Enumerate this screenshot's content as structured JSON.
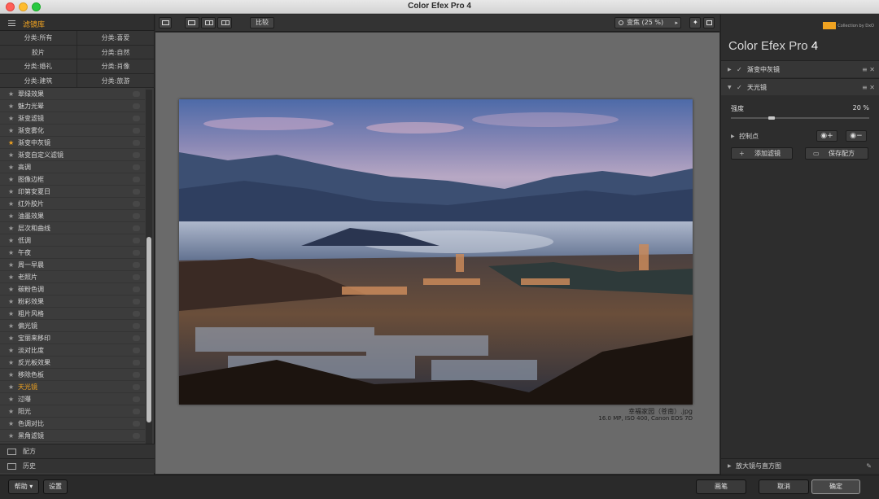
{
  "window": {
    "title": "Color Efex Pro 4"
  },
  "library": {
    "title": "滤镜库",
    "categories": [
      "分类:所有",
      "分类:喜爱",
      "胶片",
      "分类:自然",
      "分类:婚礼",
      "分类:肖像",
      "分类:建筑",
      "分类:旅游"
    ],
    "filters": [
      {
        "label": "翠绿效果",
        "favorite": false,
        "active": false
      },
      {
        "label": "魅力光晕",
        "favorite": false,
        "active": false
      },
      {
        "label": "渐变滤镜",
        "favorite": false,
        "active": false
      },
      {
        "label": "渐变雾化",
        "favorite": false,
        "active": false
      },
      {
        "label": "渐变中灰镜",
        "favorite": true,
        "active": false
      },
      {
        "label": "渐变自定义滤镜",
        "favorite": false,
        "active": false
      },
      {
        "label": "高调",
        "favorite": false,
        "active": false
      },
      {
        "label": "图像边框",
        "favorite": false,
        "active": false
      },
      {
        "label": "印第安夏日",
        "favorite": false,
        "active": false
      },
      {
        "label": "红外胶片",
        "favorite": false,
        "active": false
      },
      {
        "label": "油墨效果",
        "favorite": false,
        "active": false
      },
      {
        "label": "层次和曲线",
        "favorite": false,
        "active": false
      },
      {
        "label": "低调",
        "favorite": false,
        "active": false
      },
      {
        "label": "午夜",
        "favorite": false,
        "active": false
      },
      {
        "label": "周一早晨",
        "favorite": false,
        "active": false
      },
      {
        "label": "老照片",
        "favorite": false,
        "active": false
      },
      {
        "label": "碳粉色调",
        "favorite": false,
        "active": false
      },
      {
        "label": "粉彩效果",
        "favorite": false,
        "active": false
      },
      {
        "label": "粗片风格",
        "favorite": false,
        "active": false
      },
      {
        "label": "偏光镜",
        "favorite": false,
        "active": false
      },
      {
        "label": "宝丽来移印",
        "favorite": false,
        "active": false
      },
      {
        "label": "淡对比度",
        "favorite": false,
        "active": false
      },
      {
        "label": "反光板效果",
        "favorite": false,
        "active": false
      },
      {
        "label": "移除色板",
        "favorite": false,
        "active": false
      },
      {
        "label": "天光镜",
        "favorite": false,
        "active": true
      },
      {
        "label": "过曝",
        "favorite": false,
        "active": false
      },
      {
        "label": "阳光",
        "favorite": false,
        "active": false
      },
      {
        "label": "色调对比",
        "favorite": false,
        "active": false
      },
      {
        "label": "黑角滤镜",
        "favorite": false,
        "active": false
      }
    ],
    "recipes_label": "配方",
    "history_label": "历史"
  },
  "toolbar": {
    "compare_label": "比较",
    "zoom_label": "变焦 (25 %)"
  },
  "image": {
    "file_name": "幸福家园（苍南）.jpg",
    "meta": "16.0 MP, ISO 400, Canon EOS 7D"
  },
  "right_panel": {
    "brand_text": "Collection by DxO",
    "app_name": "Color Efex Pro",
    "app_version": "4",
    "stack": [
      {
        "label": "渐变中灰镜",
        "expanded": false
      },
      {
        "label": "天光镜",
        "expanded": true
      }
    ],
    "strength_label": "强度",
    "strength_value": "20 %",
    "strength_fraction": 0.2,
    "control_points_label": "控制点",
    "add_filter_label": "添加滤镜",
    "save_recipe_label": "保存配方",
    "loupe_label": "放大镜与直方图"
  },
  "bottom": {
    "help_label": "帮助",
    "settings_label": "设置",
    "brush_label": "画笔",
    "cancel_label": "取消",
    "ok_label": "确定"
  },
  "colors": {
    "accent": "#f0a321",
    "panel_bg": "#3a3a3a",
    "canvas_bg": "#6a6a6a"
  }
}
